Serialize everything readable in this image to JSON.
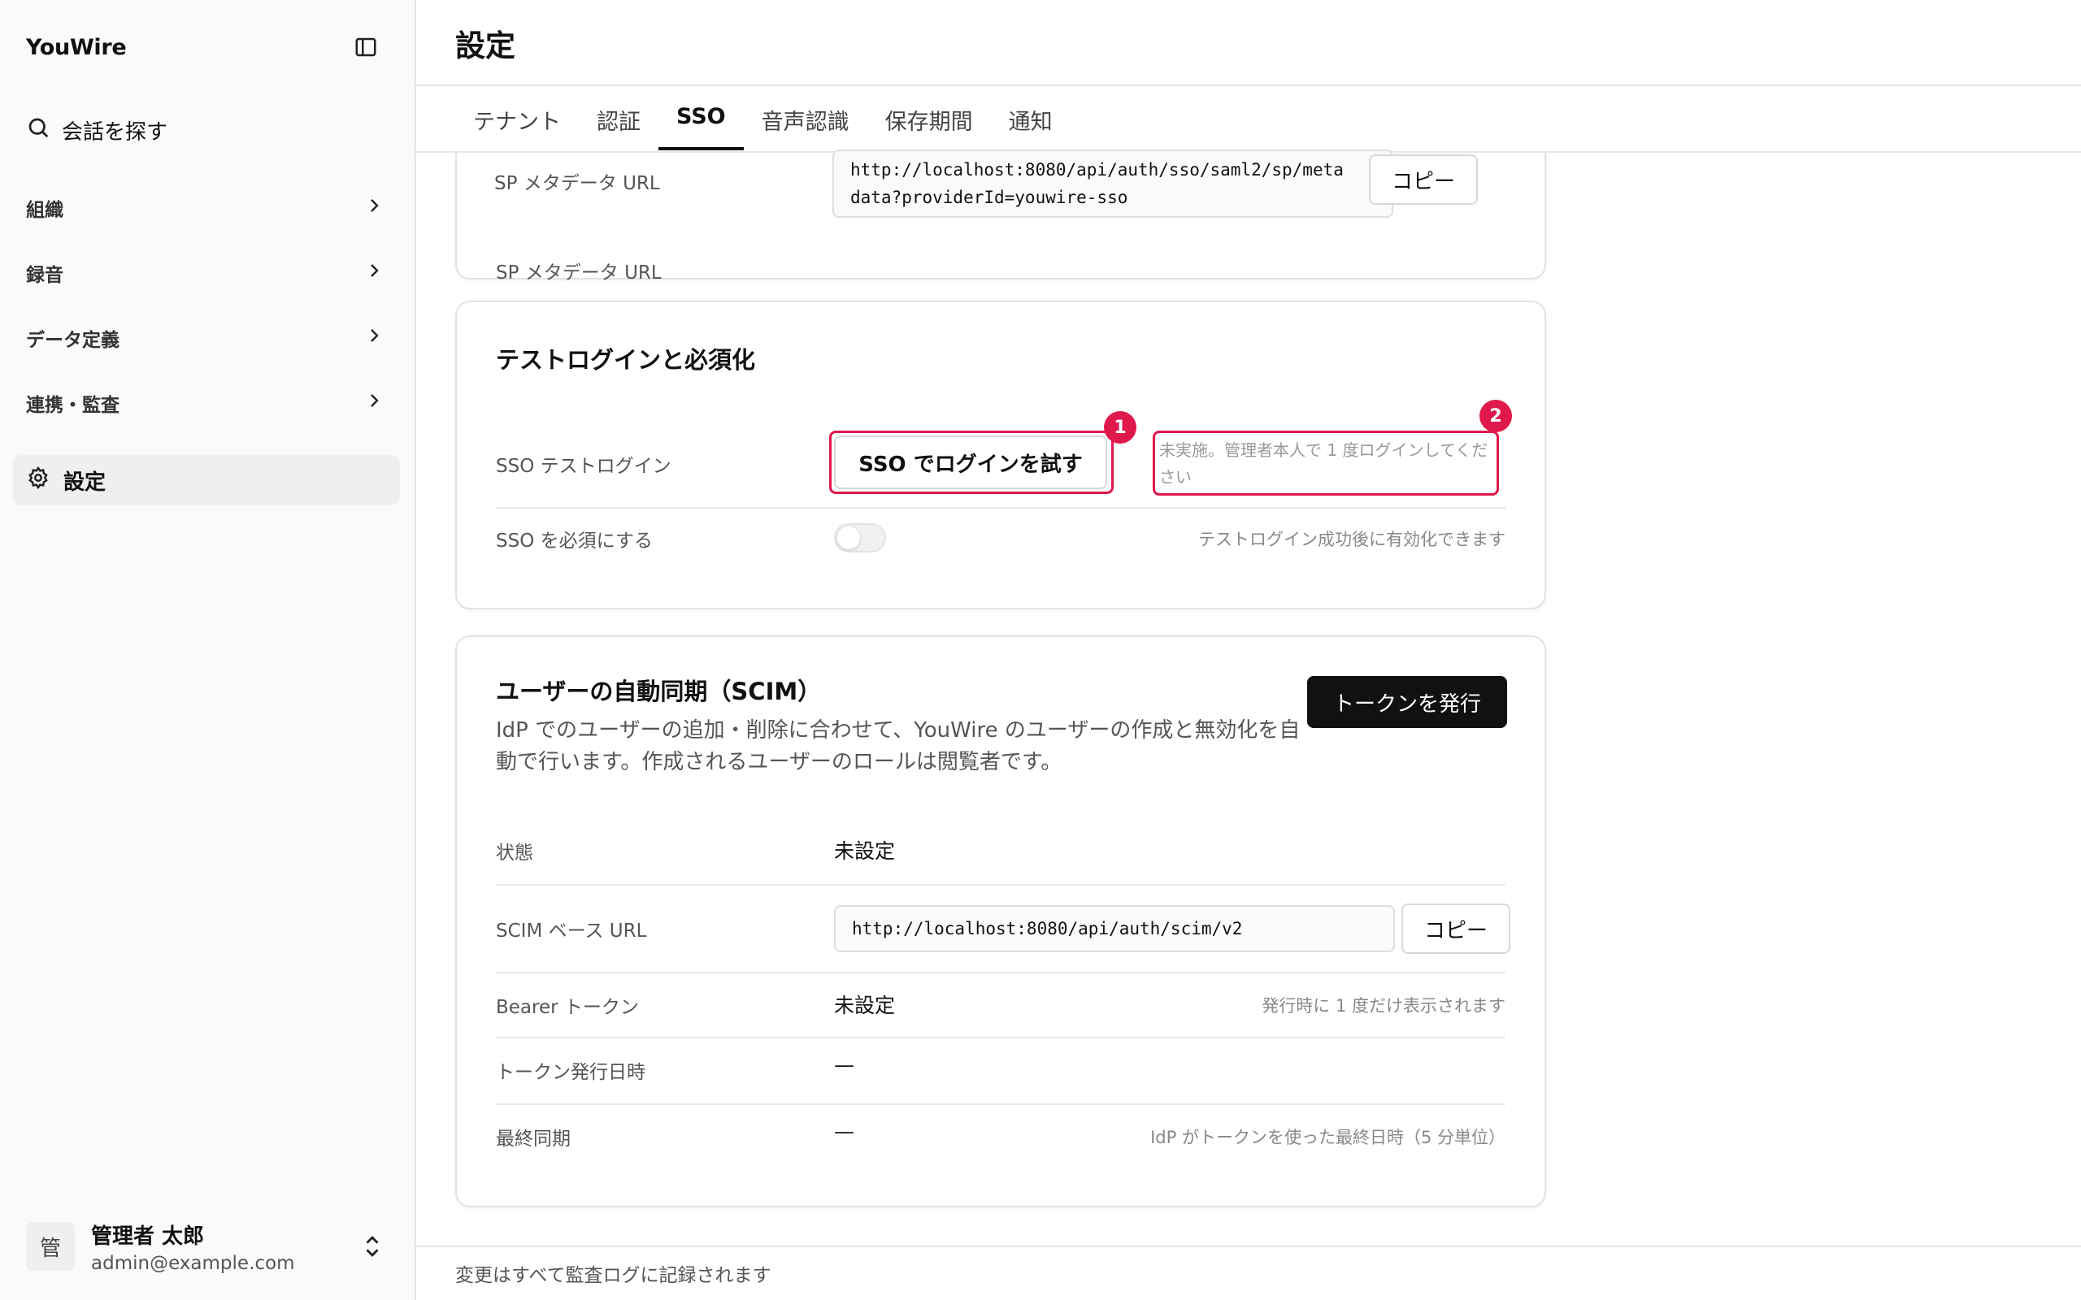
{
  "sidebar": {
    "brand": "YouWire",
    "search_label": "会話を探す",
    "nav": [
      "組織",
      "録音",
      "データ定義",
      "連携・監査"
    ],
    "active_label": "設定",
    "user": {
      "avatar": "管",
      "name": "管理者 太郎",
      "email": "admin@example.com"
    }
  },
  "header": {
    "title": "設定",
    "tabs": [
      "テナント",
      "認証",
      "SSO",
      "音声認識",
      "保存期間",
      "通知"
    ],
    "active_tab": "SSO"
  },
  "sp_card": {
    "label": "SP メタデータ URL",
    "url_line1": "http://localhost:8080/api/auth/sso/saml2/sp/meta",
    "url_line2": "data?providerId=youwire-sso",
    "copy": "コピー"
  },
  "test_card": {
    "title": "テストログインと必須化",
    "test_label": "SSO テストログイン",
    "test_button": "SSO でログインを試す",
    "test_status": "未実施。管理者本人で 1 度ログインしてください",
    "require_label": "SSO を必須にする",
    "require_hint": "テストログイン成功後に有効化できます",
    "require_enabled": false,
    "annotation_1": "1",
    "annotation_2": "2"
  },
  "scim_card": {
    "title": "ユーザーの自動同期（SCIM）",
    "description": "IdP でのユーザーの追加・削除に合わせて、YouWire のユーザーの作成と無効化を自動で行います。作成されるユーザーのロールは閲覧者です。",
    "issue_button": "トークンを発行",
    "rows": {
      "status_label": "状態",
      "status_value": "未設定",
      "base_url_label": "SCIM ベース URL",
      "base_url_value": "http://localhost:8080/api/auth/scim/v2",
      "copy": "コピー",
      "token_label": "Bearer トークン",
      "token_value": "未設定",
      "token_hint": "発行時に 1 度だけ表示されます",
      "issued_label": "トークン発行日時",
      "issued_value": "—",
      "last_sync_label": "最終同期",
      "last_sync_value": "—",
      "last_sync_hint": "IdP がトークンを使った最終日時（5 分単位）"
    }
  },
  "footer": {
    "note": "変更はすべて監査ログに記録されます"
  },
  "colors": {
    "accent_red": "#e0194d",
    "primary_dark": "#111111"
  }
}
